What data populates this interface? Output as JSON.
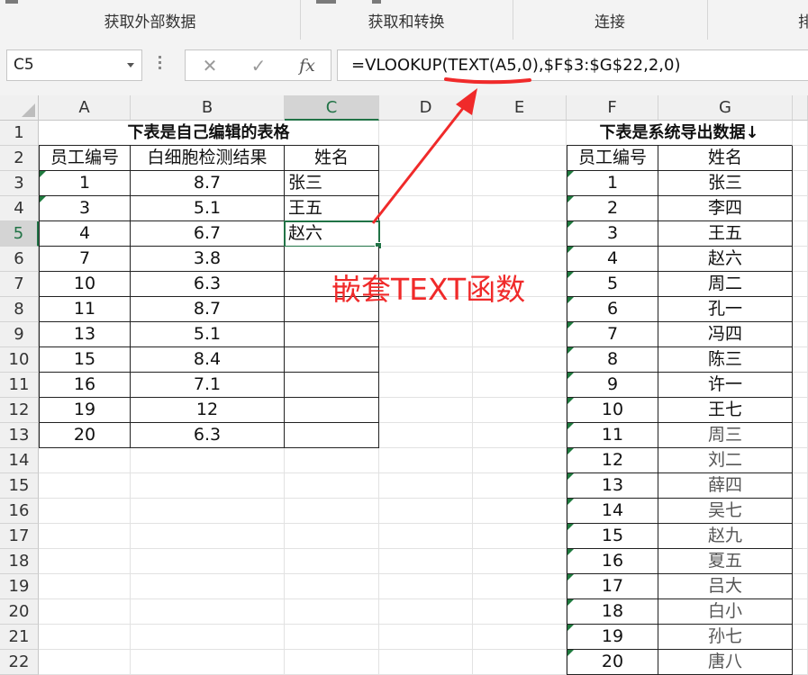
{
  "ribbon": {
    "groups": [
      {
        "label": "获取外部数据"
      },
      {
        "label": "获取和转换"
      },
      {
        "label": "连接"
      },
      {
        "label": "排"
      }
    ]
  },
  "formula_bar": {
    "name_box": "C5",
    "cancel_icon": "close-icon",
    "enter_icon": "check-icon",
    "fx_label": "fx",
    "formula": "=VLOOKUP(TEXT(A5,0),$F$3:$G$22,2,0)"
  },
  "sheet": {
    "columns": [
      "A",
      "B",
      "C",
      "D",
      "E",
      "F",
      "G"
    ],
    "rows": [
      "1",
      "2",
      "3",
      "4",
      "5",
      "6",
      "7",
      "8",
      "9",
      "10",
      "11",
      "12",
      "13",
      "14",
      "15",
      "16",
      "17",
      "18",
      "19",
      "20",
      "21",
      "22"
    ],
    "selected_cell": "C5",
    "left_table": {
      "title": "下表是自己编辑的表格",
      "headers": [
        "员工编号",
        "白细胞检测结果",
        "姓名"
      ],
      "rows": [
        [
          "1",
          "8.7",
          "张三"
        ],
        [
          "3",
          "5.1",
          "王五"
        ],
        [
          "4",
          "6.7",
          "赵六"
        ],
        [
          "7",
          "3.8",
          ""
        ],
        [
          "10",
          "6.3",
          ""
        ],
        [
          "11",
          "8.7",
          ""
        ],
        [
          "13",
          "5.1",
          ""
        ],
        [
          "15",
          "8.4",
          ""
        ],
        [
          "16",
          "7.1",
          ""
        ],
        [
          "19",
          "12",
          ""
        ],
        [
          "20",
          "6.3",
          ""
        ]
      ]
    },
    "right_table": {
      "title": "下表是系统导出数据↓",
      "headers": [
        "员工编号",
        "姓名"
      ],
      "rows": [
        [
          "1",
          "张三"
        ],
        [
          "2",
          "李四"
        ],
        [
          "3",
          "王五"
        ],
        [
          "4",
          "赵六"
        ],
        [
          "5",
          "周二"
        ],
        [
          "6",
          "孔一"
        ],
        [
          "7",
          "冯四"
        ],
        [
          "8",
          "陈三"
        ],
        [
          "9",
          "许一"
        ],
        [
          "10",
          "王七"
        ],
        [
          "11",
          "周三"
        ],
        [
          "12",
          "刘二"
        ],
        [
          "13",
          "薛四"
        ],
        [
          "14",
          "吴七"
        ],
        [
          "15",
          "赵九"
        ],
        [
          "16",
          "夏五"
        ],
        [
          "17",
          "吕大"
        ],
        [
          "18",
          "白小"
        ],
        [
          "19",
          "孙七"
        ],
        [
          "20",
          "唐八"
        ]
      ]
    }
  },
  "annotation": {
    "text": "嵌套TEXT函数",
    "color": "#f02a2a"
  }
}
